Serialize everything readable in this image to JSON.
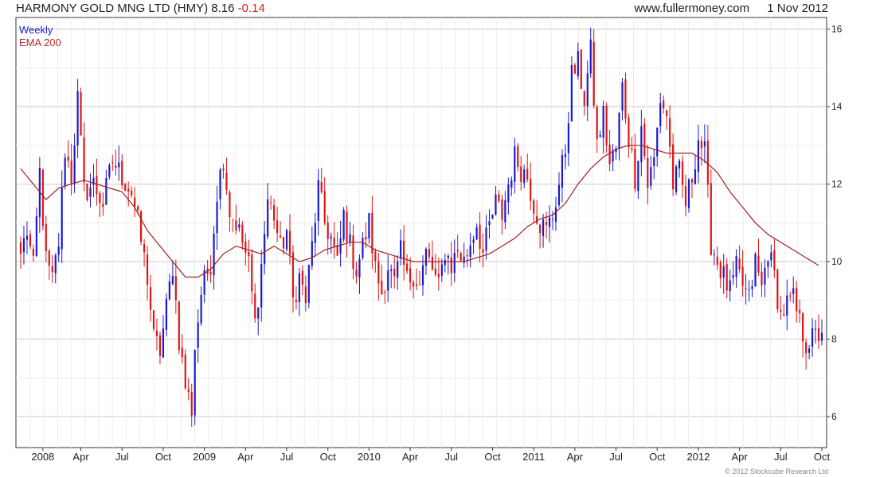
{
  "header": {
    "title": "HARMONY GOLD MNG LTD (HMY)",
    "last": "8.16",
    "change": "-0.14",
    "site": "www.fullermoney.com",
    "date": "1 Nov 2012"
  },
  "legend": {
    "weekly": "Weekly",
    "ema": "EMA 200"
  },
  "copyright": "© 2012 Stockcube Research Ltd",
  "colors": {
    "up": "#1a1acc",
    "down": "#dd1515",
    "ema": "#a02020",
    "grid": "#dcdcdc",
    "axis": "#333333"
  },
  "chart_data": {
    "type": "candlestick",
    "title": "HARMONY GOLD MNG LTD (HMY) 8.16 -0.14",
    "y_axis_side": "right",
    "ylim": [
      5.2,
      16.3
    ],
    "yticks": [
      6,
      8,
      10,
      12,
      14,
      16
    ],
    "grid": true,
    "legend_placement": "top-left",
    "x_domain_weeks": [
      0,
      253
    ],
    "x_ticks": [
      {
        "label": "2008",
        "week": 7
      },
      {
        "label": "Apr",
        "week": 19
      },
      {
        "label": "Jul",
        "week": 32
      },
      {
        "label": "Oct",
        "week": 45
      },
      {
        "label": "2009",
        "week": 58
      },
      {
        "label": "Apr",
        "week": 71
      },
      {
        "label": "Jul",
        "week": 84
      },
      {
        "label": "Oct",
        "week": 97
      },
      {
        "label": "2010",
        "week": 110
      },
      {
        "label": "Apr",
        "week": 123
      },
      {
        "label": "Jul",
        "week": 136
      },
      {
        "label": "Oct",
        "week": 149
      },
      {
        "label": "2011",
        "week": 162
      },
      {
        "label": "Apr",
        "week": 175
      },
      {
        "label": "Jul",
        "week": 188
      },
      {
        "label": "Oct",
        "week": 201
      },
      {
        "label": "2012",
        "week": 214
      },
      {
        "label": "Apr",
        "week": 227
      },
      {
        "label": "Jul",
        "week": 240
      },
      {
        "label": "Oct",
        "week": 253
      }
    ],
    "series": [
      {
        "name": "Weekly",
        "kind": "ohlc",
        "note": "closing-price path; open = previous close; up candles blue, down candles red",
        "waypoints": [
          [
            0,
            10.2
          ],
          [
            2,
            10.8
          ],
          [
            4,
            9.8
          ],
          [
            6,
            12.3
          ],
          [
            8,
            10.0
          ],
          [
            10,
            9.5
          ],
          [
            12,
            10.5
          ],
          [
            14,
            12.9
          ],
          [
            16,
            12.2
          ],
          [
            18,
            14.2
          ],
          [
            20,
            11.8
          ],
          [
            23,
            12.0
          ],
          [
            26,
            11.5
          ],
          [
            29,
            12.6
          ],
          [
            32,
            12.2
          ],
          [
            35,
            11.8
          ],
          [
            37,
            11.0
          ],
          [
            40,
            9.6
          ],
          [
            42,
            8.0
          ],
          [
            44,
            7.7
          ],
          [
            46,
            8.8
          ],
          [
            48,
            9.9
          ],
          [
            50,
            8.0
          ],
          [
            52,
            6.8
          ],
          [
            54,
            6.2
          ],
          [
            55,
            7.8
          ],
          [
            57,
            9.2
          ],
          [
            60,
            10.0
          ],
          [
            62,
            11.8
          ],
          [
            64,
            12.7
          ],
          [
            66,
            11.3
          ],
          [
            68,
            11.0
          ],
          [
            70,
            10.5
          ],
          [
            72,
            9.9
          ],
          [
            74,
            8.4
          ],
          [
            76,
            9.9
          ],
          [
            78,
            11.6
          ],
          [
            80,
            11.2
          ],
          [
            82,
            10.3
          ],
          [
            84,
            10.8
          ],
          [
            86,
            9.0
          ],
          [
            88,
            9.6
          ],
          [
            90,
            9.0
          ],
          [
            92,
            10.4
          ],
          [
            94,
            11.9
          ],
          [
            96,
            11.0
          ],
          [
            98,
            10.6
          ],
          [
            100,
            9.9
          ],
          [
            102,
            11.2
          ],
          [
            104,
            10.4
          ],
          [
            106,
            9.8
          ],
          [
            108,
            10.4
          ],
          [
            110,
            11.0
          ],
          [
            112,
            9.8
          ],
          [
            114,
            9.2
          ],
          [
            116,
            9.9
          ],
          [
            118,
            9.4
          ],
          [
            120,
            10.2
          ],
          [
            122,
            9.5
          ],
          [
            124,
            9.7
          ],
          [
            126,
            9.4
          ],
          [
            128,
            10.2
          ],
          [
            130,
            9.8
          ],
          [
            132,
            9.3
          ],
          [
            134,
            10.3
          ],
          [
            136,
            9.9
          ],
          [
            138,
            10.3
          ],
          [
            140,
            10.0
          ],
          [
            142,
            10.5
          ],
          [
            144,
            11.0
          ],
          [
            146,
            10.2
          ],
          [
            148,
            10.9
          ],
          [
            150,
            11.5
          ],
          [
            152,
            11.2
          ],
          [
            154,
            12.0
          ],
          [
            156,
            12.7
          ],
          [
            158,
            12.4
          ],
          [
            160,
            12.2
          ],
          [
            162,
            11.5
          ],
          [
            164,
            11.0
          ],
          [
            166,
            10.8
          ],
          [
            168,
            11.2
          ],
          [
            170,
            12.0
          ],
          [
            172,
            12.9
          ],
          [
            174,
            14.8
          ],
          [
            176,
            15.1
          ],
          [
            178,
            14.2
          ],
          [
            180,
            15.4
          ],
          [
            182,
            13.0
          ],
          [
            184,
            13.8
          ],
          [
            186,
            12.5
          ],
          [
            188,
            12.9
          ],
          [
            190,
            14.5
          ],
          [
            192,
            13.2
          ],
          [
            194,
            12.2
          ],
          [
            196,
            13.5
          ],
          [
            198,
            12.0
          ],
          [
            200,
            12.6
          ],
          [
            202,
            14.2
          ],
          [
            204,
            13.8
          ],
          [
            206,
            12.0
          ],
          [
            208,
            12.3
          ],
          [
            210,
            11.5
          ],
          [
            212,
            12.2
          ],
          [
            214,
            13.2
          ],
          [
            216,
            12.8
          ],
          [
            218,
            10.5
          ],
          [
            220,
            10.0
          ],
          [
            222,
            9.6
          ],
          [
            224,
            9.2
          ],
          [
            226,
            9.8
          ],
          [
            228,
            9.4
          ],
          [
            230,
            9.0
          ],
          [
            232,
            10.0
          ],
          [
            234,
            9.3
          ],
          [
            236,
            10.3
          ],
          [
            238,
            9.6
          ],
          [
            240,
            8.6
          ],
          [
            242,
            8.9
          ],
          [
            244,
            9.0
          ],
          [
            246,
            8.4
          ],
          [
            248,
            7.9
          ],
          [
            250,
            8.0
          ],
          [
            253,
            8.16
          ]
        ]
      },
      {
        "name": "EMA 200",
        "kind": "line",
        "points": [
          [
            0,
            12.4
          ],
          [
            4,
            12.0
          ],
          [
            8,
            11.6
          ],
          [
            12,
            11.9
          ],
          [
            16,
            12.0
          ],
          [
            20,
            12.1
          ],
          [
            24,
            12.0
          ],
          [
            28,
            11.9
          ],
          [
            32,
            11.8
          ],
          [
            36,
            11.4
          ],
          [
            40,
            10.8
          ],
          [
            44,
            10.4
          ],
          [
            48,
            10.0
          ],
          [
            52,
            9.6
          ],
          [
            56,
            9.6
          ],
          [
            60,
            9.8
          ],
          [
            64,
            10.2
          ],
          [
            68,
            10.4
          ],
          [
            72,
            10.3
          ],
          [
            76,
            10.2
          ],
          [
            80,
            10.4
          ],
          [
            84,
            10.2
          ],
          [
            88,
            10.0
          ],
          [
            92,
            10.1
          ],
          [
            96,
            10.3
          ],
          [
            100,
            10.4
          ],
          [
            104,
            10.5
          ],
          [
            108,
            10.5
          ],
          [
            112,
            10.3
          ],
          [
            116,
            10.2
          ],
          [
            120,
            10.1
          ],
          [
            124,
            10.0
          ],
          [
            128,
            10.0
          ],
          [
            132,
            10.0
          ],
          [
            136,
            10.0
          ],
          [
            140,
            10.0
          ],
          [
            144,
            10.1
          ],
          [
            148,
            10.2
          ],
          [
            152,
            10.4
          ],
          [
            156,
            10.6
          ],
          [
            160,
            10.9
          ],
          [
            164,
            11.1
          ],
          [
            168,
            11.2
          ],
          [
            172,
            11.5
          ],
          [
            176,
            12.0
          ],
          [
            180,
            12.4
          ],
          [
            184,
            12.7
          ],
          [
            188,
            12.9
          ],
          [
            192,
            13.0
          ],
          [
            196,
            13.0
          ],
          [
            200,
            12.9
          ],
          [
            204,
            12.8
          ],
          [
            208,
            12.8
          ],
          [
            212,
            12.8
          ],
          [
            216,
            12.6
          ],
          [
            220,
            12.3
          ],
          [
            224,
            11.8
          ],
          [
            228,
            11.4
          ],
          [
            232,
            11.0
          ],
          [
            236,
            10.7
          ],
          [
            240,
            10.5
          ],
          [
            244,
            10.3
          ],
          [
            248,
            10.1
          ],
          [
            252,
            9.9
          ]
        ]
      }
    ]
  }
}
